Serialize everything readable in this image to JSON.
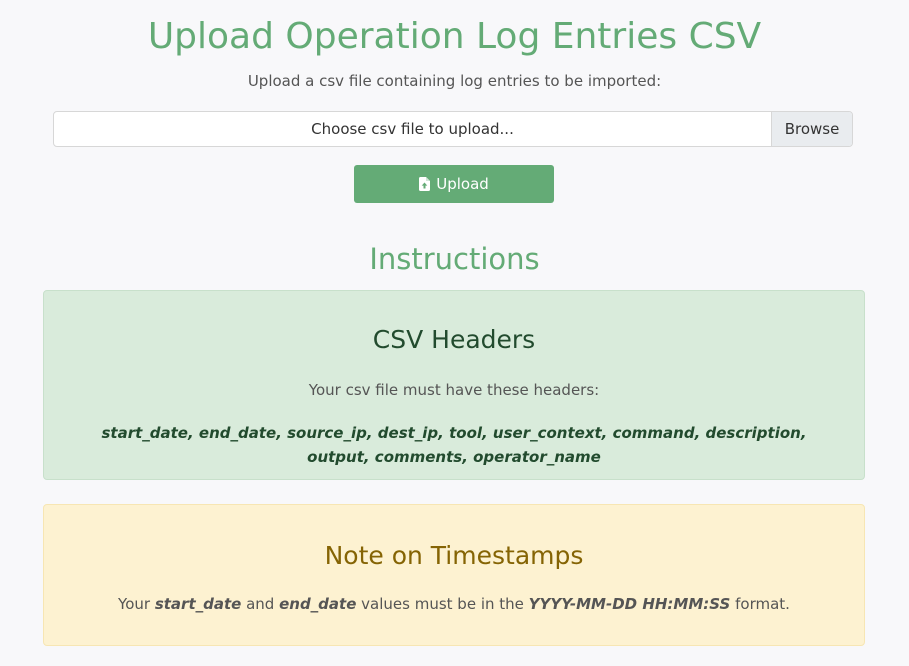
{
  "page": {
    "title": "Upload Operation Log Entries CSV",
    "subtitle": "Upload a csv file containing log entries to be imported:"
  },
  "file_input": {
    "placeholder": "Choose csv file to upload...",
    "browse_label": "Browse"
  },
  "upload_button": {
    "label": "Upload",
    "icon": "file-upload-icon"
  },
  "instructions": {
    "title": "Instructions",
    "csv_headers": {
      "title": "CSV Headers",
      "text": "Your csv file must have these headers:",
      "headers": "start_date, end_date, source_ip, dest_ip, tool, user_context, command, description, output, comments, operator_name"
    },
    "timestamps": {
      "title": "Note on Timestamps",
      "text_1": "Your ",
      "field_1": "start_date",
      "text_2": " and ",
      "field_2": "end_date",
      "text_3": " values must be in the ",
      "format": "YYYY-MM-DD HH:MM:SS",
      "text_4": " format."
    }
  },
  "colors": {
    "accent": "#64ab76",
    "success_bg": "#d9ebdb",
    "warning_bg": "#fdf2d1",
    "warning_text": "#856404"
  }
}
